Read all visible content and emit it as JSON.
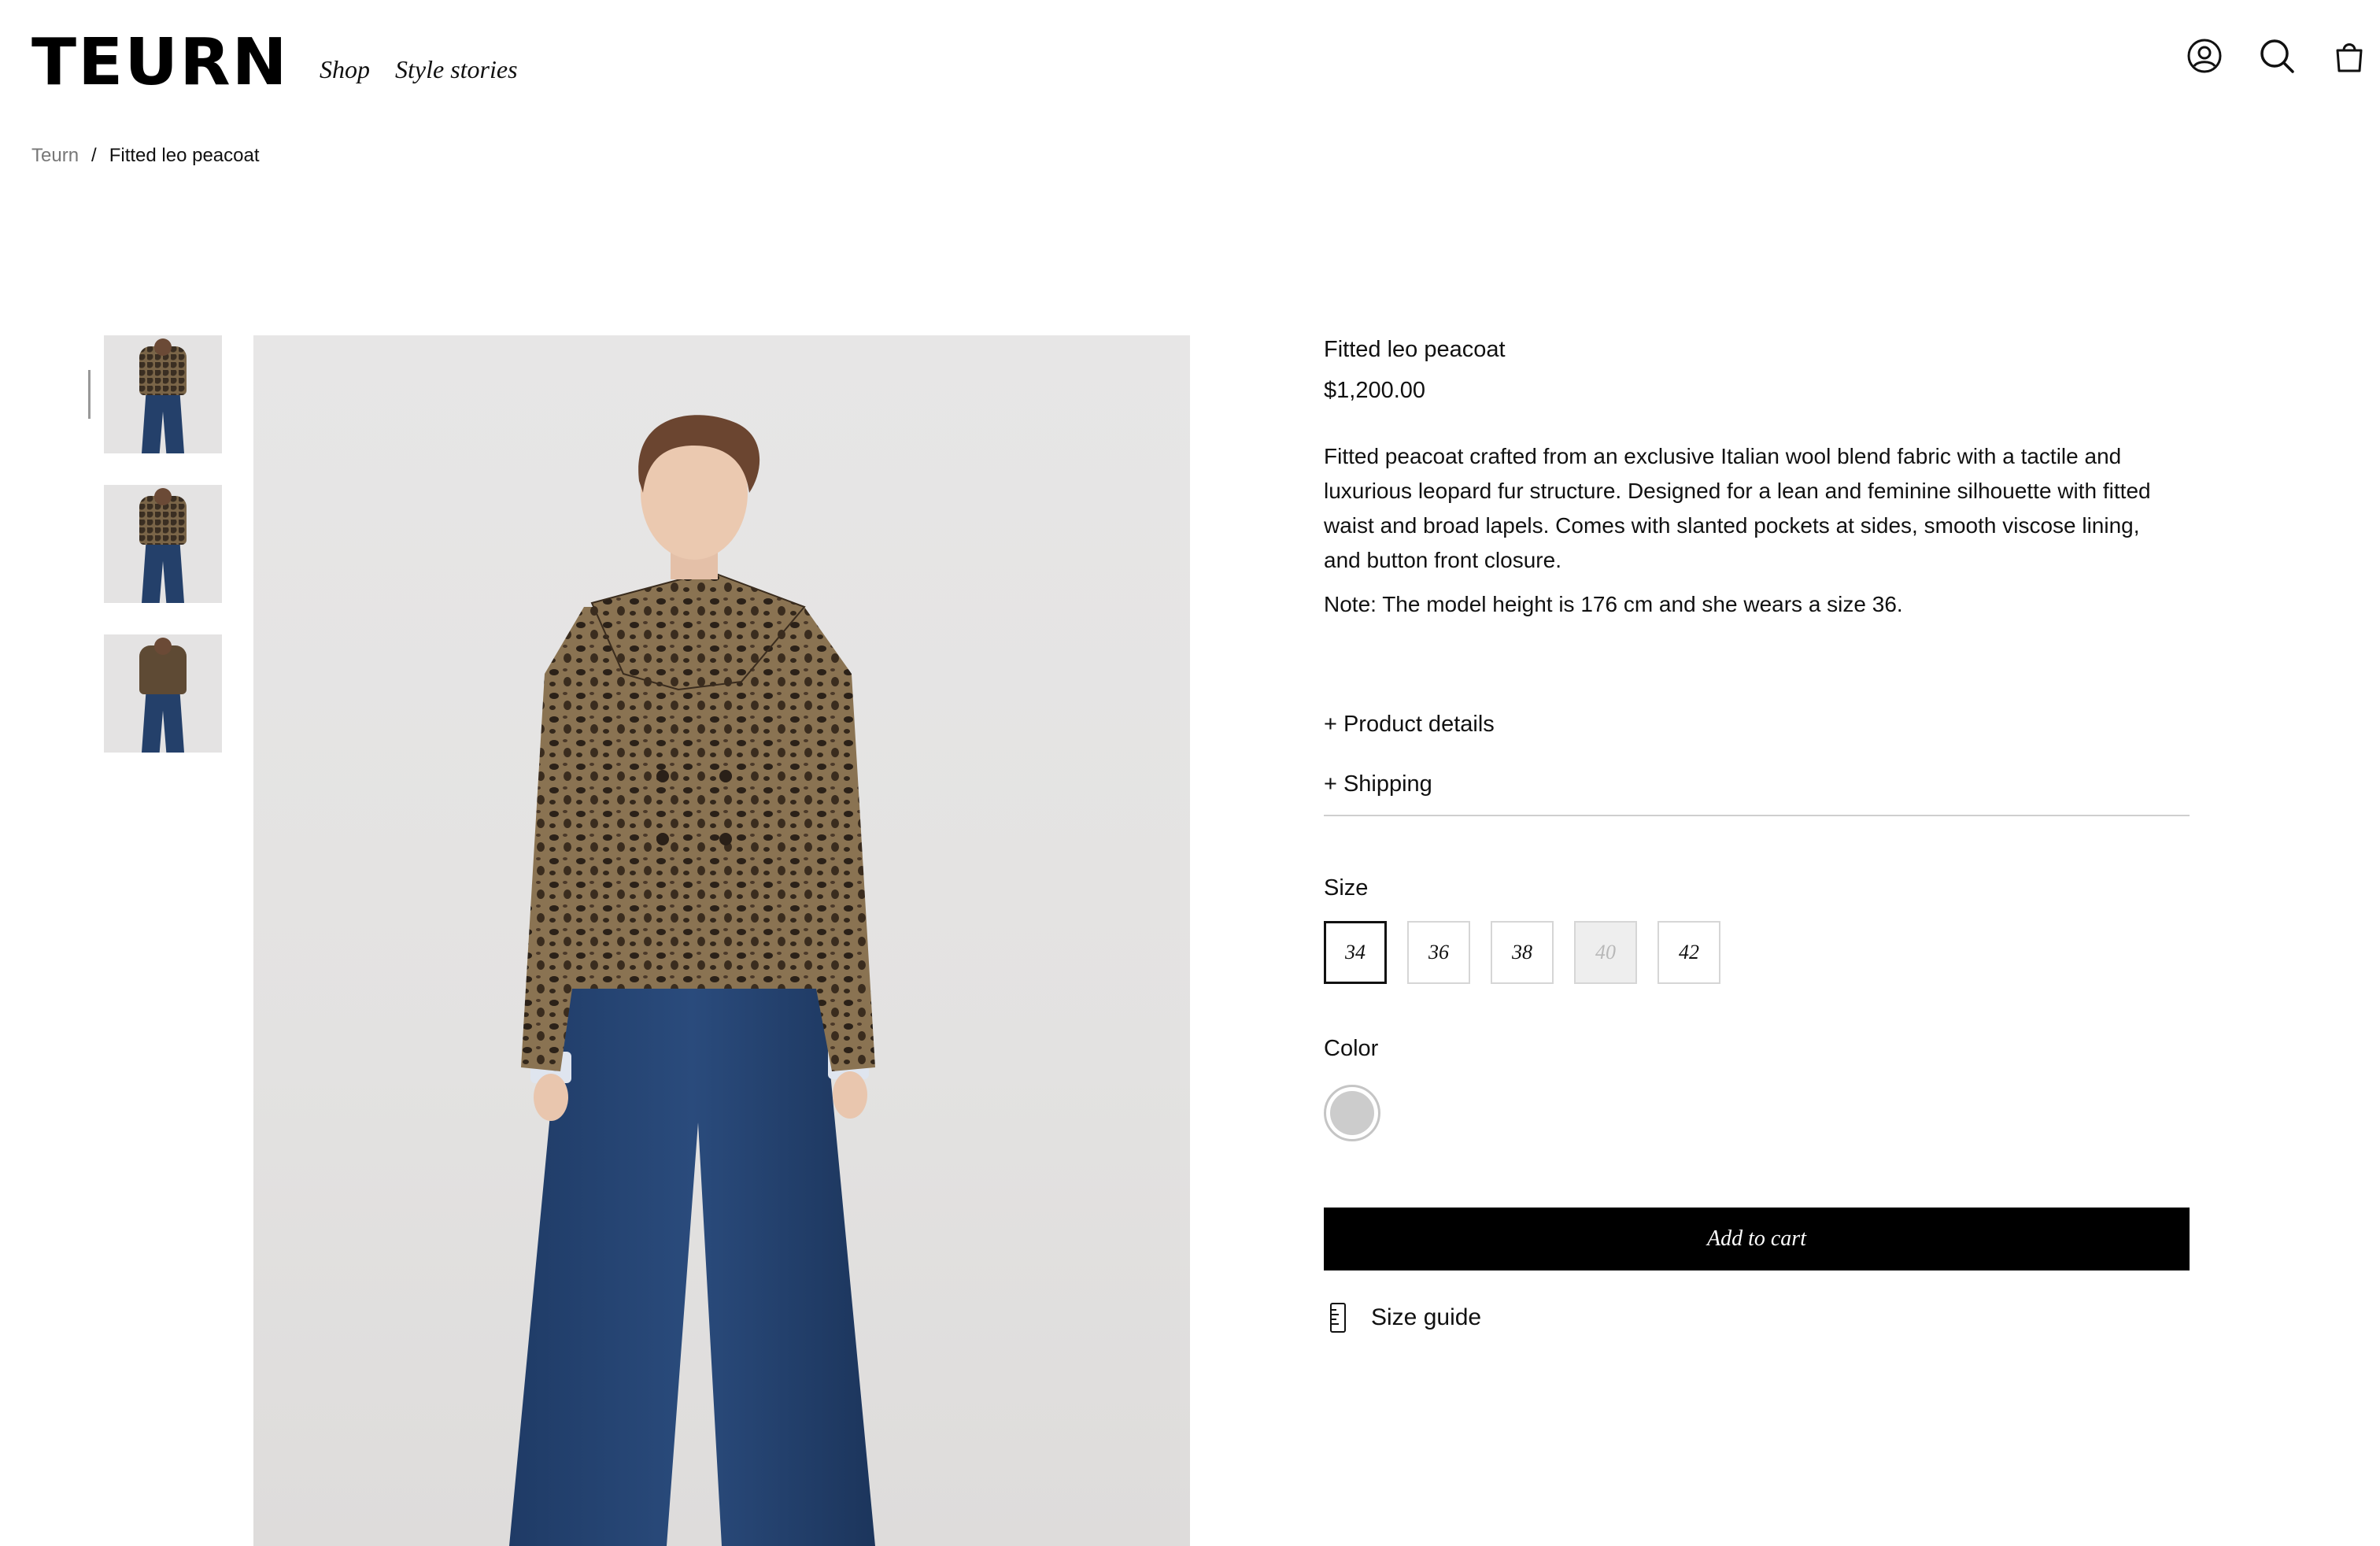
{
  "brand": {
    "logo_text": "TEURN"
  },
  "nav": {
    "items": [
      "Shop",
      "Style stories"
    ]
  },
  "header_icons": [
    "account-icon",
    "search-icon",
    "cart-icon"
  ],
  "breadcrumb": {
    "home": "Teurn",
    "separator": "/",
    "current": "Fitted leo peacoat"
  },
  "gallery": {
    "thumbnails": [
      "front view",
      "three-quarter view",
      "back view"
    ],
    "active_index": 0
  },
  "product": {
    "title": "Fitted leo peacoat",
    "price": "$1,200.00",
    "description": "Fitted peacoat crafted from an exclusive Italian wool blend fabric with a tactile and luxurious leopard fur structure. Designed for a lean and feminine silhouette with fitted waist and broad lapels. Comes with slanted pockets at sides, smooth viscose lining, and button front closure.",
    "note": "Note: The model height is 176 cm and she wears a size 36.",
    "accordions": {
      "details": "Product details",
      "shipping": "Shipping"
    },
    "size_label": "Size",
    "sizes": [
      "34",
      "36",
      "38",
      "40",
      "42"
    ],
    "selected_size": "34",
    "unavailable_sizes": [
      "40"
    ],
    "color_label": "Color",
    "color_swatch": "#cccccc",
    "add_to_cart": "Add to cart",
    "size_guide": "Size guide"
  },
  "colors": {
    "accent": "#000000",
    "text": "#111111",
    "muted": "#777777",
    "divider": "#cfcfcf"
  }
}
